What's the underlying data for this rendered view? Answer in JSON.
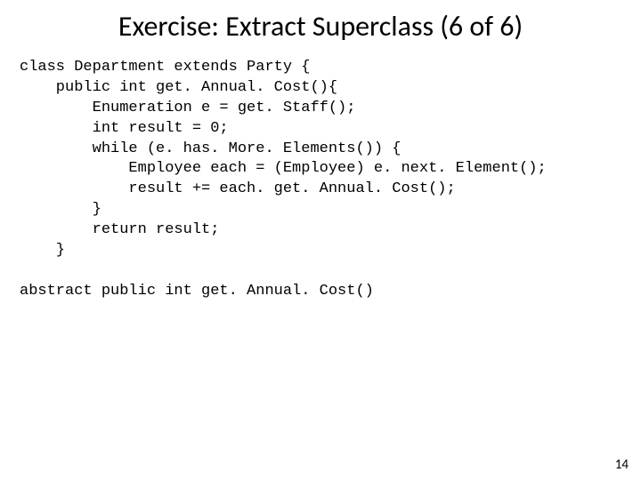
{
  "title": "Exercise: Extract Superclass (6 of 6)",
  "code": {
    "l1": "class Department extends Party {",
    "l2": "    public int get. Annual. Cost(){",
    "l3": "        Enumeration e = get. Staff();",
    "l4": "        int result = 0;",
    "l5": "        while (e. has. More. Elements()) {",
    "l6": "            Employee each = (Employee) e. next. Element();",
    "l7": "            result += each. get. Annual. Cost();",
    "l8": "        }",
    "l9": "        return result;",
    "l10": "    }",
    "blank": "",
    "l11": "abstract public int get. Annual. Cost()"
  },
  "pagenum": "14"
}
